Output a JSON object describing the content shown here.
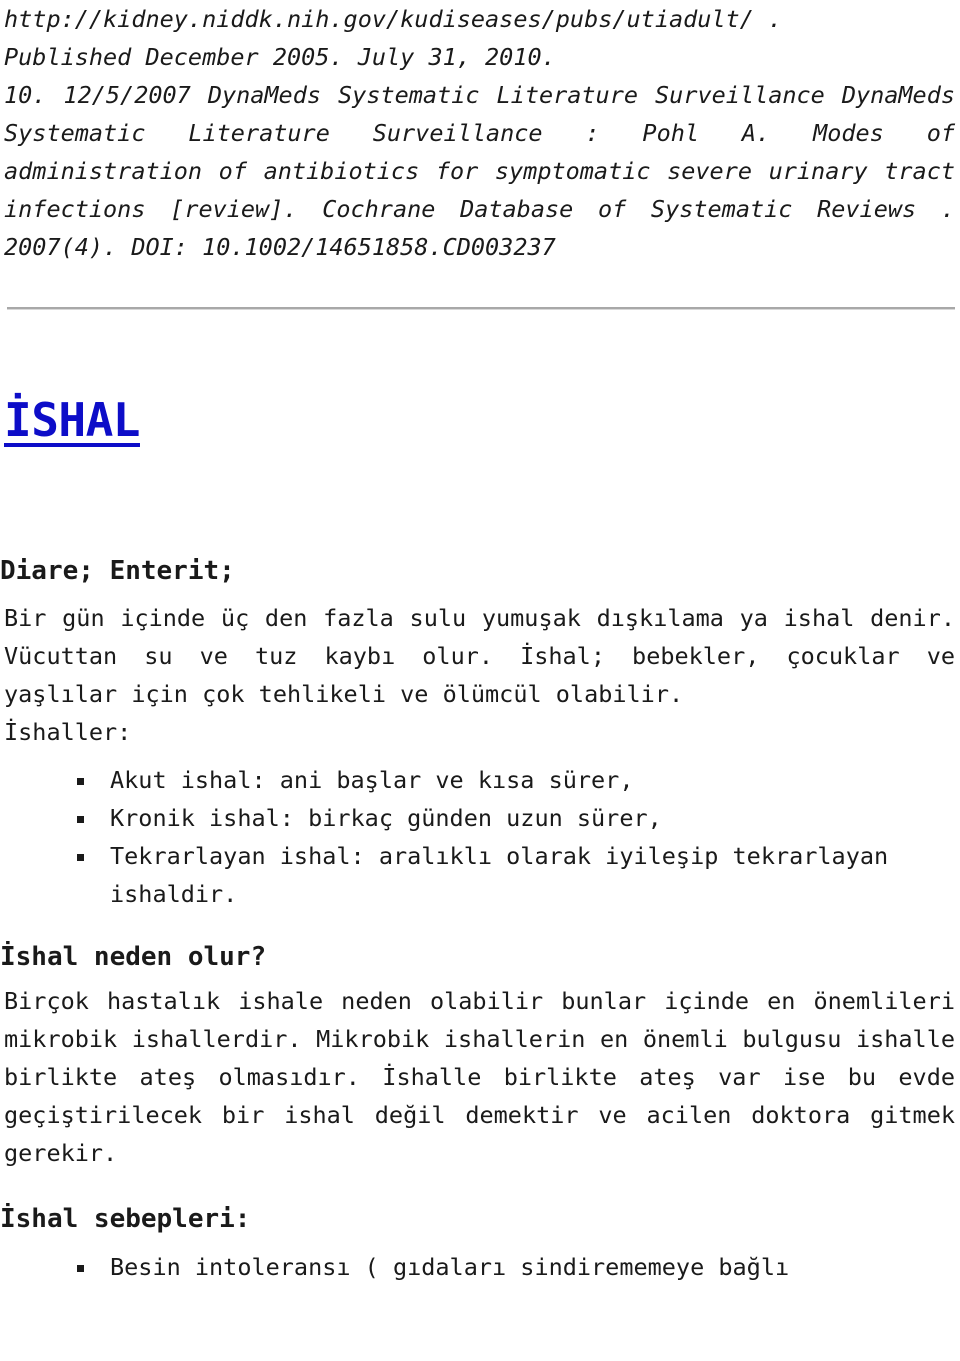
{
  "document": {
    "language": "tr",
    "colors": {
      "title_link": "#0d0dc8",
      "text": "#1a1a1a",
      "divider": "#a8a8a8",
      "background": "#ffffff"
    }
  },
  "references": {
    "line_1": "http://kidney.niddk.nih.gov/kudiseases/pubs/utiadult/  .",
    "line_2": "Published December 2005. July 31, 2010.",
    "item_10": "10. 12/5/2007 DynaMeds Systematic Literature Surveillance DynaMeds Systematic Literature Surveillance : Pohl A. Modes of administration of antibiotics for symptomatic severe urinary tract infections [review]. Cochrane Database of Systematic Reviews . 2007(4). DOI: 10.1002/14651858.CD003237"
  },
  "title": {
    "text": "İSHAL"
  },
  "sections": {
    "synonyms_heading": "Diare; Enterit;",
    "definition_paragraph": "Bir gün içinde üç den fazla sulu yumuşak dışkılama ya ishal denir. Vücuttan su ve tuz kaybı olur. İshal; bebekler, çocuklar ve yaşlılar için çok tehlikeli ve ölümcül olabilir.",
    "types_label": "İshaller:",
    "types": [
      "Akut ishal: ani başlar ve kısa sürer,",
      "Kronik ishal: birkaç günden uzun sürer,",
      "Tekrarlayan ishal: aralıklı olarak iyileşip tekrarlayan ishaldir."
    ],
    "causes_heading": "İshal neden olur?",
    "causes_paragraph": "Birçok hastalık ishale neden olabilir bunlar içinde en önemlileri mikrobik ishallerdir. Mikrobik ishallerin en önemli bulgusu ishalle birlikte ateş olmasıdır. İshalle birlikte ateş var ise bu evde geçiştirilecek bir ishal değil demektir ve acilen doktora gitmek gerekir.",
    "reasons_heading": "İshal sebepleri:",
    "reasons": [
      "Besin intoleransı ( gıdaları sindirememeye bağlı"
    ]
  },
  "icons": {
    "bullet": "square-bullet-icon"
  }
}
